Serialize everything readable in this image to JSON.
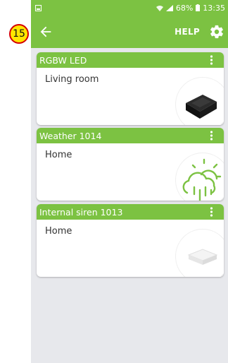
{
  "annotation": {
    "number": "15"
  },
  "status_bar": {
    "signal": "📶",
    "battery": "68%",
    "time": "13:35"
  },
  "app_bar": {
    "help_label": "HELP"
  },
  "devices": [
    {
      "name": "RGBW LED",
      "room": "Living room",
      "icon": "led-controller-image"
    },
    {
      "name": "Weather 1014",
      "room": "Home",
      "icon": "weather-cloud-sun-rain-icon"
    },
    {
      "name": "Internal siren 1013",
      "room": "Home",
      "icon": "siren-device-image"
    }
  ],
  "colors": {
    "accent": "#7cc242",
    "background": "#e7e8ec"
  }
}
